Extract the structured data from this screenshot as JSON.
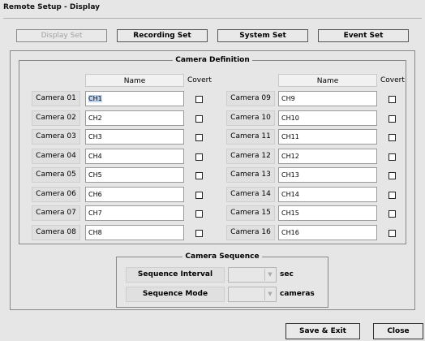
{
  "window": {
    "title": "Remote Setup - Display"
  },
  "tabs": [
    {
      "label": "Display Set",
      "enabled": false
    },
    {
      "label": "Recording Set",
      "enabled": true
    },
    {
      "label": "System Set",
      "enabled": true
    },
    {
      "label": "Event Set",
      "enabled": true
    }
  ],
  "camera_definition": {
    "legend": "Camera Definition",
    "header_name": "Name",
    "header_covert": "Covert",
    "left": [
      {
        "label": "Camera 01",
        "name": "CH1",
        "covert": false
      },
      {
        "label": "Camera 02",
        "name": "CH2",
        "covert": false
      },
      {
        "label": "Camera 03",
        "name": "CH3",
        "covert": false
      },
      {
        "label": "Camera 04",
        "name": "CH4",
        "covert": false
      },
      {
        "label": "Camera 05",
        "name": "CH5",
        "covert": false
      },
      {
        "label": "Camera 06",
        "name": "CH6",
        "covert": false
      },
      {
        "label": "Camera 07",
        "name": "CH7",
        "covert": false
      },
      {
        "label": "Camera 08",
        "name": "CH8",
        "covert": false
      }
    ],
    "right": [
      {
        "label": "Camera 09",
        "name": "CH9",
        "covert": false
      },
      {
        "label": "Camera 10",
        "name": "CH10",
        "covert": false
      },
      {
        "label": "Camera 11",
        "name": "CH11",
        "covert": false
      },
      {
        "label": "Camera 12",
        "name": "CH12",
        "covert": false
      },
      {
        "label": "Camera 13",
        "name": "CH13",
        "covert": false
      },
      {
        "label": "Camera 14",
        "name": "CH14",
        "covert": false
      },
      {
        "label": "Camera 15",
        "name": "CH15",
        "covert": false
      },
      {
        "label": "Camera 16",
        "name": "CH16",
        "covert": false
      }
    ]
  },
  "camera_sequence": {
    "legend": "Camera Sequence",
    "interval_label": "Sequence Interval",
    "interval_value": "",
    "interval_unit": "sec",
    "mode_label": "Sequence Mode",
    "mode_value": "",
    "mode_unit": "cameras"
  },
  "footer": {
    "save_exit": "Save & Exit",
    "close": "Close"
  },
  "colors": {
    "window_bg": "#e6e6e6",
    "selection": "#bcd2ee"
  }
}
